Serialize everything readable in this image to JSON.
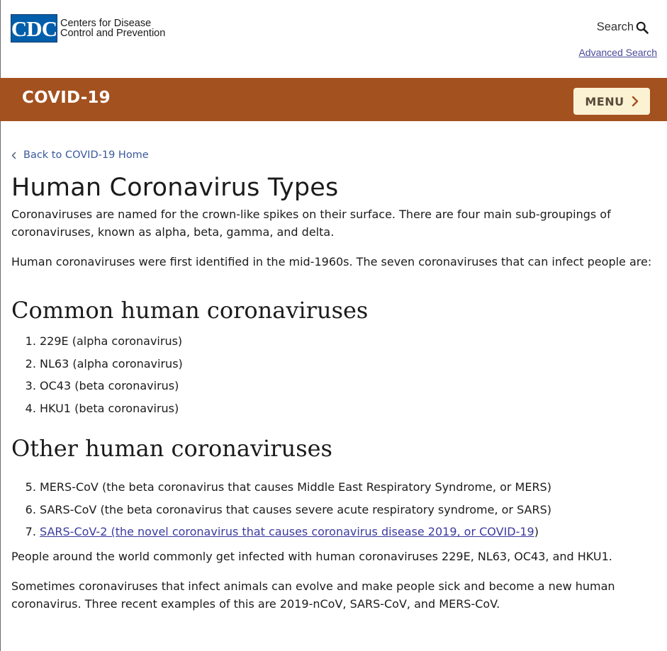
{
  "header": {
    "logo_abbr": "CDC",
    "logo_line1": "Centers for Disease",
    "logo_line2": "Control and Prevention",
    "search_label": "Search",
    "advanced_search_label": "Advanced Search"
  },
  "banner": {
    "title": "COVID-19",
    "menu_label": "MENU",
    "color": "#a3511f",
    "menu_bg": "#fbf2d3"
  },
  "content": {
    "back_link": "Back to COVID-19 Home",
    "title": "Human Coronavirus Types",
    "intro": "Coronaviruses are named for the crown-like spikes on their surface. There are four main sub-groupings of coronaviruses, known as alpha, beta, gamma, and delta.",
    "second": "Human coronaviruses were first identified in the mid-1960s. The seven coronaviruses that can infect people are:",
    "common_heading": "Common human coronaviruses",
    "common_list": [
      "229E (alpha coronavirus)",
      "NL63 (alpha coronavirus)",
      "OC43 (beta coronavirus)",
      "HKU1 (beta coronavirus)"
    ],
    "other_heading": "Other human coronaviruses",
    "other_list": [
      "MERS-CoV (the beta coronavirus that causes Middle East Respiratory Syndrome, or MERS)",
      "SARS-CoV (the beta coronavirus that causes severe acute respiratory syndrome, or SARS)"
    ],
    "other_link_text": "SARS-CoV-2 (the novel coronavirus that causes coronavirus disease 2019, or COVID-19",
    "other_link_suffix": ")",
    "after_list": "People around the world commonly get infected with human coronaviruses 229E, NL63, OC43, and HKU1.",
    "last": "Sometimes coronaviruses that infect animals can evolve and make people sick and become a new human coronavirus. Three recent examples of this are 2019-nCoV, SARS-CoV, and MERS-CoV."
  },
  "icons": {
    "search": "search-icon",
    "chevron_right": "chevron-right-icon",
    "chevron_left": "chevron-left-icon"
  }
}
